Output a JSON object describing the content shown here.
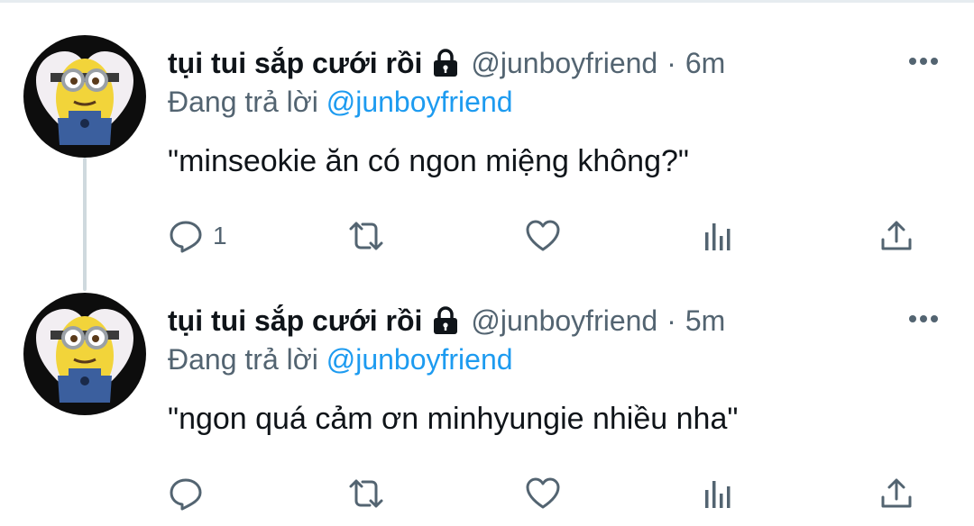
{
  "tweets": [
    {
      "display_name": "tụi tui sắp cưới rồi",
      "handle": "@junboyfriend",
      "separator": "·",
      "time": "6m",
      "replying_prefix": "Đang trả lời",
      "replying_to": "@junboyfriend",
      "text": "\"minseokie ăn có ngon miệng không?\"",
      "reply_count": "1"
    },
    {
      "display_name": "tụi tui sắp cưới rồi",
      "handle": "@junboyfriend",
      "separator": "·",
      "time": "5m",
      "replying_prefix": "Đang trả lời",
      "replying_to": "@junboyfriend",
      "text": "\"ngon quá cảm ơn minhyungie nhiều nha\"",
      "reply_count": ""
    }
  ],
  "icons": {
    "lock": "lock-icon",
    "more": "more-icon",
    "reply": "reply-icon",
    "retweet": "retweet-icon",
    "like": "like-icon",
    "analytics": "analytics-icon",
    "share": "share-icon"
  },
  "colors": {
    "text_primary": "#0f1419",
    "text_secondary": "#536471",
    "mention": "#1d9bf0",
    "thread_line": "#cfd9de"
  }
}
